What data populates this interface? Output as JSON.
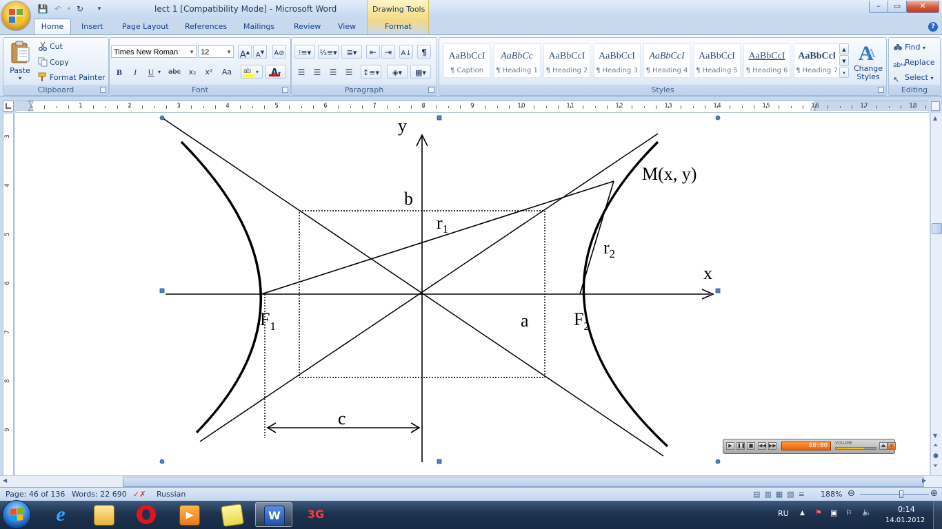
{
  "window": {
    "title": "lect 1 [Compatibility Mode] - Microsoft Word",
    "context_tab_group": "Drawing Tools",
    "controls": {
      "minimize": "–",
      "maximize": "▭",
      "close": "✕"
    }
  },
  "tabs": [
    {
      "label": "Home",
      "active": true
    },
    {
      "label": "Insert"
    },
    {
      "label": "Page Layout"
    },
    {
      "label": "References"
    },
    {
      "label": "Mailings"
    },
    {
      "label": "Review"
    },
    {
      "label": "View"
    },
    {
      "label": "Format",
      "contextual": true
    }
  ],
  "ribbon": {
    "clipboard": {
      "label": "Clipboard",
      "paste": "Paste",
      "cut": "Cut",
      "copy": "Copy",
      "format_painter": "Format Painter"
    },
    "font": {
      "label": "Font",
      "font_name": "Times New Roman",
      "font_size": "12",
      "grow": "A",
      "shrink": "A",
      "bold": "B",
      "italic": "I",
      "underline": "U",
      "strike": "abc",
      "subscript": "x₂",
      "superscript": "x²",
      "change_case": "Aa",
      "font_color": "A"
    },
    "paragraph": {
      "label": "Paragraph",
      "show_marks": "¶"
    },
    "styles": {
      "label": "Styles",
      "items": [
        {
          "sample": "AaBbCcI",
          "name": "¶ Caption"
        },
        {
          "sample": "AaBbCc",
          "name": "¶ Heading 1"
        },
        {
          "sample": "AaBbCcI",
          "name": "¶ Heading 2"
        },
        {
          "sample": "AaBbCcI",
          "name": "¶ Heading 3"
        },
        {
          "sample": "AaBbCcI",
          "name": "¶ Heading 4"
        },
        {
          "sample": "AaBbCcI",
          "name": "¶ Heading 5"
        },
        {
          "sample": "AaBbCcI",
          "name": "¶ Heading 6"
        },
        {
          "sample": "AaBbCcl",
          "name": "¶ Heading 7"
        }
      ],
      "change_styles": "Change Styles"
    },
    "editing": {
      "label": "Editing",
      "find": "Find",
      "replace": "Replace",
      "select": "Select"
    }
  },
  "ruler": {
    "numbers": [
      "1",
      "2",
      "3",
      "4",
      "5",
      "6",
      "7",
      "8",
      "9",
      "10",
      "11",
      "12",
      "13",
      "14",
      "15",
      "16",
      "17",
      "18"
    ]
  },
  "vruler": {
    "numbers": [
      "3",
      "4",
      "5",
      "6",
      "7",
      "8",
      "9"
    ]
  },
  "figure": {
    "labels": {
      "y_axis": "y",
      "x_axis": "x",
      "point": "M(x, y)",
      "b": "b",
      "r1": "r",
      "r1_sub": "1",
      "r2": "r",
      "r2_sub": "2",
      "f1": "F",
      "f1_sub": "1",
      "f2": "F",
      "f2_sub": "2",
      "a": "a",
      "c": "c"
    }
  },
  "status": {
    "page": "Page: 46 of 136",
    "words": "Words: 22 690",
    "language": "Russian",
    "zoom": "188%",
    "zoom_fraction": 0.6
  },
  "media_player": {
    "time": "00:00",
    "volume_label": "VOLUME"
  },
  "taskbar": {
    "language": "RU",
    "time": "0:14",
    "date": "14.01.2012"
  },
  "colors": {
    "ribbon_text": "#15428b",
    "curve": "#000000",
    "handle": "#4f81bd"
  }
}
